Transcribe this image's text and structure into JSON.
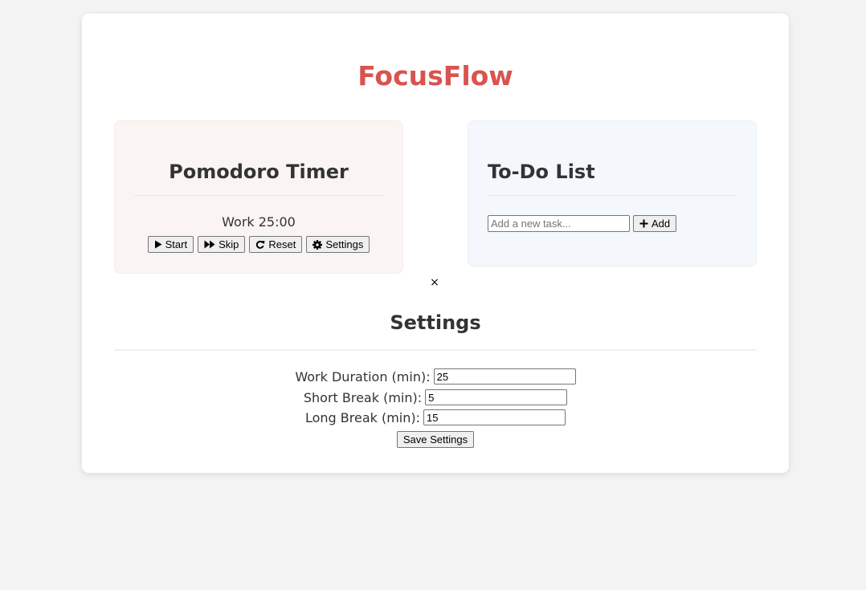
{
  "app": {
    "title": "FocusFlow",
    "accent_color": "#d9534f"
  },
  "timer": {
    "title": "Pomodoro Timer",
    "mode": "Work",
    "time": "25:00",
    "display": "Work 25:00",
    "buttons": {
      "start": {
        "label": "Start",
        "icon": "play-icon"
      },
      "skip": {
        "label": "Skip",
        "icon": "fast-forward-icon"
      },
      "reset": {
        "label": "Reset",
        "icon": "redo-icon"
      },
      "settings": {
        "label": "Settings",
        "icon": "gear-icon"
      }
    }
  },
  "todo": {
    "title": "To-Do List",
    "input_placeholder": "Add a new task...",
    "input_value": "",
    "add_label": "Add",
    "add_icon": "plus-icon"
  },
  "settings": {
    "close_symbol": "×",
    "title": "Settings",
    "fields": {
      "work": {
        "label": "Work Duration (min):",
        "value": "25"
      },
      "short_break": {
        "label": "Short Break (min):",
        "value": "5"
      },
      "long_break": {
        "label": "Long Break (min):",
        "value": "15"
      }
    },
    "save_label": "Save Settings"
  }
}
